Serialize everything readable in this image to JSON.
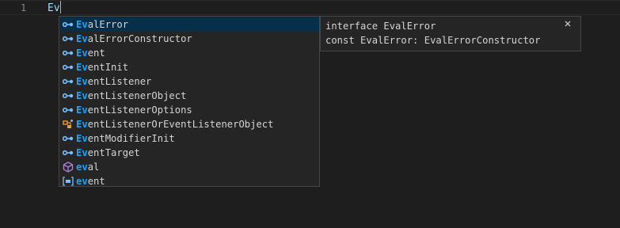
{
  "editor": {
    "line_number": "1",
    "code_text": "Ev"
  },
  "suggest": {
    "items": [
      {
        "match": "Ev",
        "rest": "alError",
        "kind": "interface-icon"
      },
      {
        "match": "Ev",
        "rest": "alErrorConstructor",
        "kind": "interface-icon"
      },
      {
        "match": "Ev",
        "rest": "ent",
        "kind": "interface-icon"
      },
      {
        "match": "Ev",
        "rest": "entInit",
        "kind": "interface-icon"
      },
      {
        "match": "Ev",
        "rest": "entListener",
        "kind": "interface-icon"
      },
      {
        "match": "Ev",
        "rest": "entListenerObject",
        "kind": "interface-icon"
      },
      {
        "match": "Ev",
        "rest": "entListenerOptions",
        "kind": "interface-icon"
      },
      {
        "match": "Ev",
        "rest": "entListenerOrEventListenerObject",
        "kind": "type-alias-icon"
      },
      {
        "match": "Ev",
        "rest": "entModifierInit",
        "kind": "interface-icon"
      },
      {
        "match": "Ev",
        "rest": "entTarget",
        "kind": "interface-icon"
      },
      {
        "match": "ev",
        "rest": "al",
        "kind": "function-cube-icon"
      },
      {
        "match": "ev",
        "rest": "ent",
        "kind": "variable-icon"
      }
    ]
  },
  "details": {
    "line1": "interface EvalError",
    "line2": "const EvalError: EvalErrorConstructor",
    "close_glyph": "×"
  },
  "colors": {
    "editor_bg": "#1e1e1e",
    "widget_bg": "#252526",
    "widget_border": "#454545",
    "focused_bg": "#062f4a",
    "match_highlight": "#18a3ff",
    "text": "#d4d4d4",
    "interface_icon": "#75beff",
    "type_alias_icon": "#ee9d28",
    "function_icon": "#b180d7",
    "variable_icon": "#75beff"
  }
}
